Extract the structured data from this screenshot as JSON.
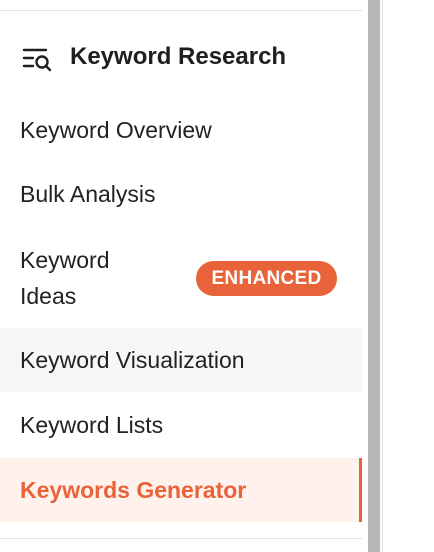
{
  "section": {
    "title": "Keyword Research",
    "icon": "list-search-icon"
  },
  "menu": {
    "items": [
      {
        "label": "Keyword Overview"
      },
      {
        "label": "Bulk Analysis"
      },
      {
        "label": "Keyword Ideas",
        "badge": "ENHANCED"
      },
      {
        "label": "Keyword Visualization"
      },
      {
        "label": "Keyword Lists"
      },
      {
        "label": "Keywords Generator",
        "active": true
      }
    ]
  },
  "colors": {
    "accent": "#e8633a",
    "active_background": "#fff1ec",
    "hover_background": "#f7f7f7",
    "scrollbar": "#b7b7b7"
  }
}
